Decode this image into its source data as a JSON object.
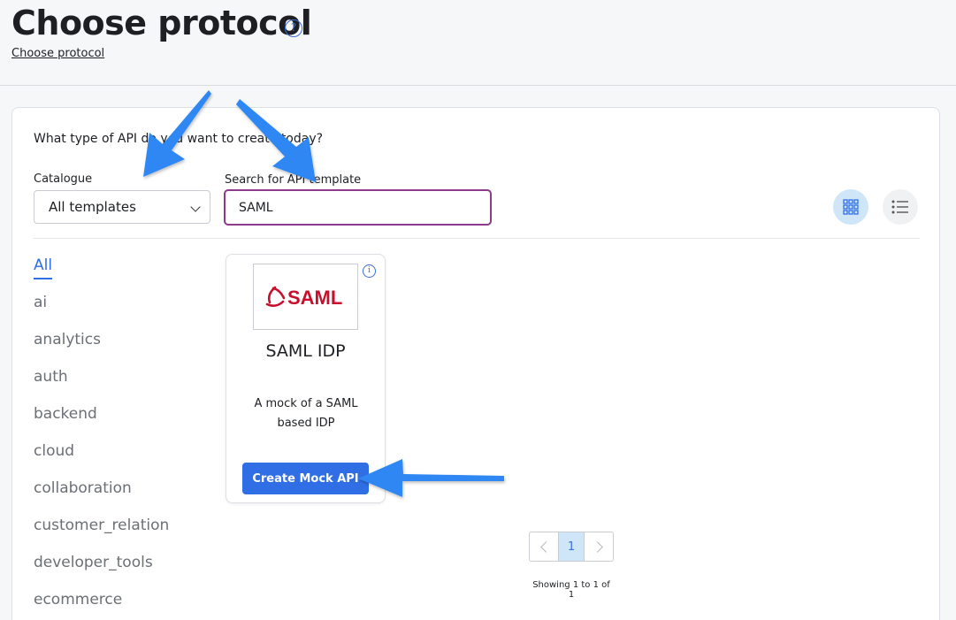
{
  "header": {
    "title": "Choose protocol",
    "help_icon": "?",
    "breadcrumb": "Choose protocol"
  },
  "form": {
    "question": "What type of API do you want to create today?",
    "catalogue_label": "Catalogue",
    "catalogue_value": "All templates",
    "search_label": "Search for API template",
    "search_value": "SAML"
  },
  "view_toggle": {
    "grid_icon": "grid-icon",
    "list_icon": "list-icon",
    "active": "grid"
  },
  "categories": [
    {
      "label": "All",
      "active": true
    },
    {
      "label": "ai"
    },
    {
      "label": "analytics"
    },
    {
      "label": "auth"
    },
    {
      "label": "backend"
    },
    {
      "label": "cloud"
    },
    {
      "label": "collaboration"
    },
    {
      "label": "customer_relation"
    },
    {
      "label": "developer_tools"
    },
    {
      "label": "ecommerce"
    }
  ],
  "templates": [
    {
      "logo_text": "SAML",
      "title": "SAML IDP",
      "description": "A mock of a SAML based IDP",
      "info_icon": "i",
      "button_label": "Create Mock API"
    }
  ],
  "pagination": {
    "current_page": "1",
    "showing": "Showing 1 to 1 of 1"
  },
  "colors": {
    "accent": "#2f6ee5",
    "search_border": "#8d3b8a",
    "saml_red": "#c8102e",
    "arrow": "#2f87f2"
  }
}
